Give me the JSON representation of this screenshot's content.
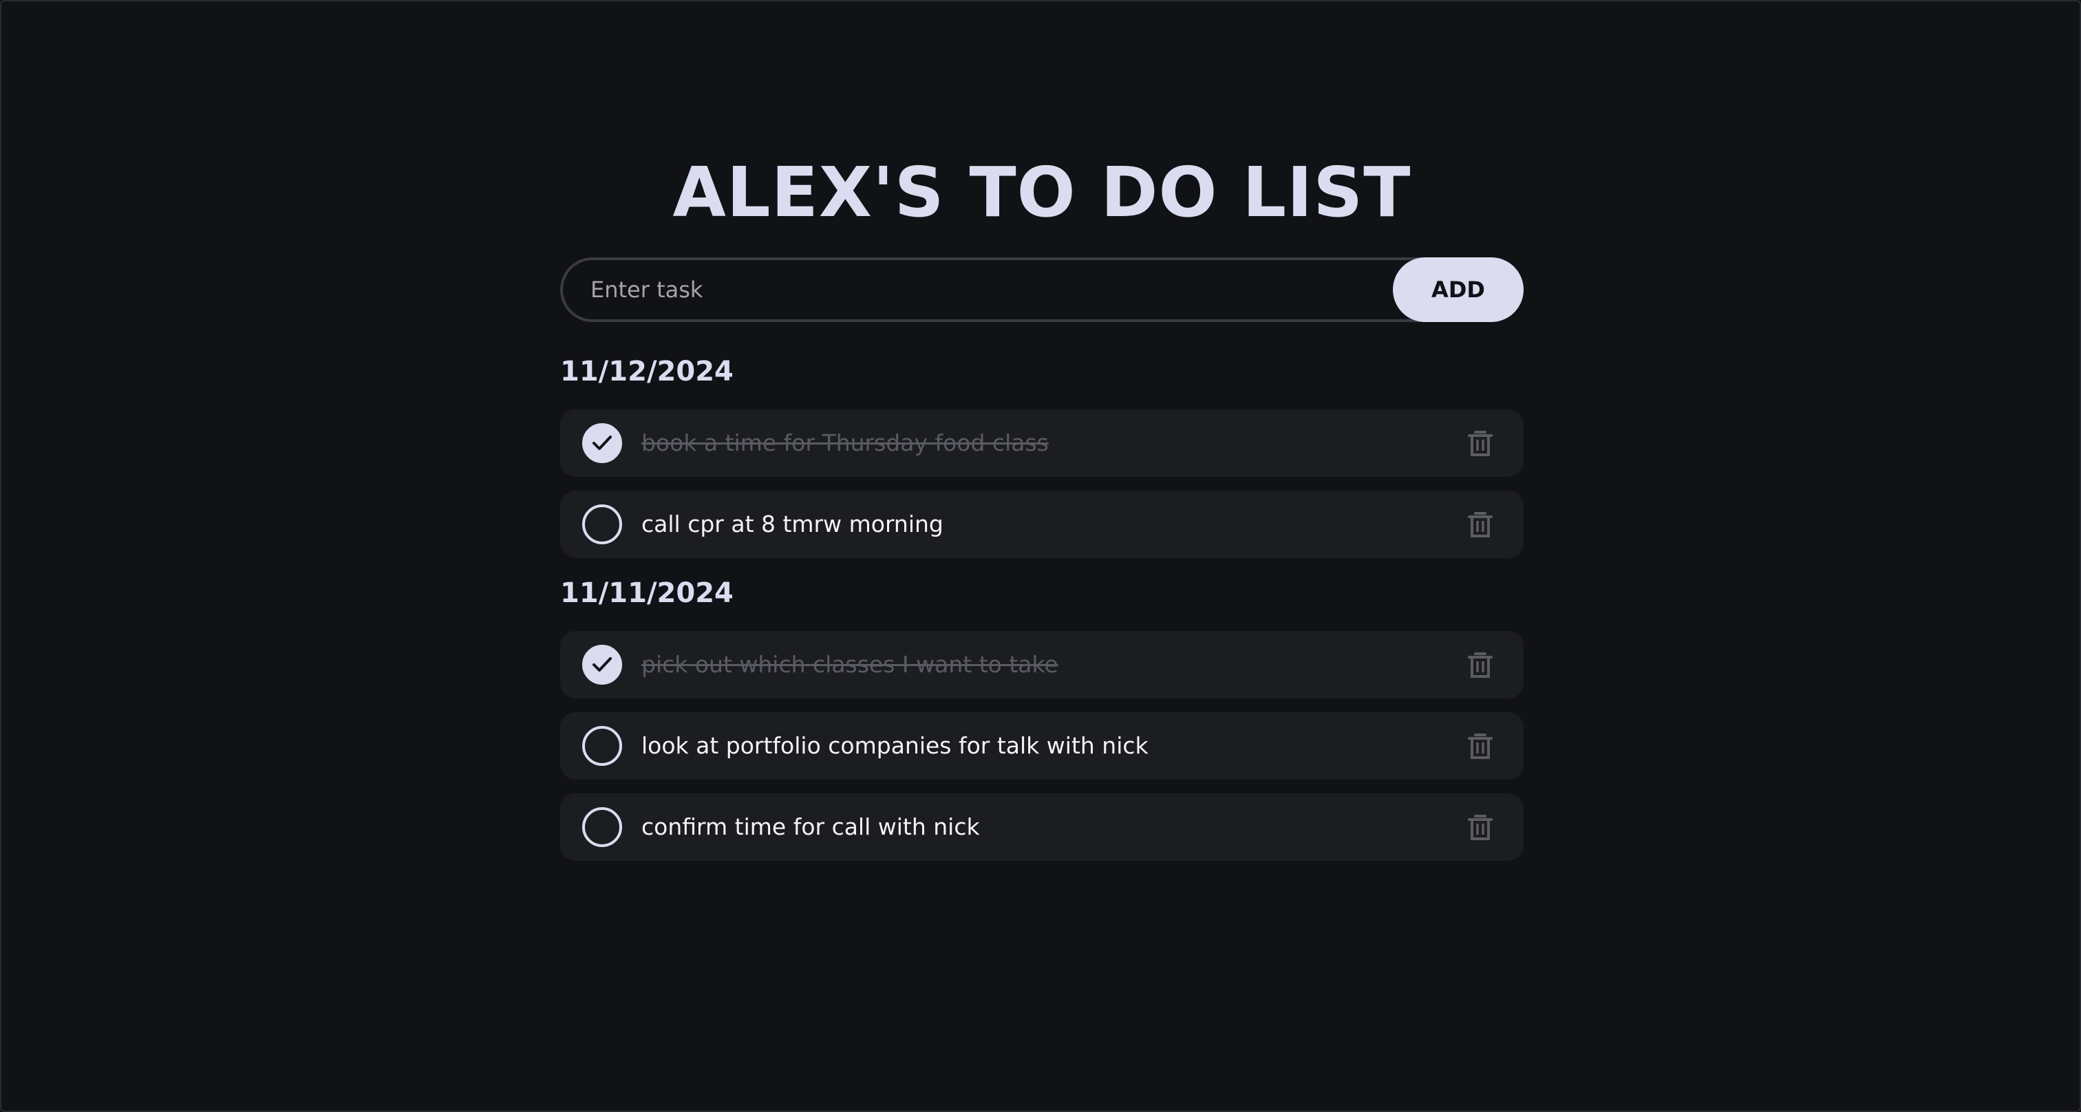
{
  "title": "ALEX'S TO DO LIST",
  "input": {
    "placeholder": "Enter task",
    "value": ""
  },
  "add_button_label": "ADD",
  "colors": {
    "background": "#111216",
    "accent": "#dcdcf0",
    "row_background": "#1c1d21",
    "done_text": "#5a5b62"
  },
  "groups": [
    {
      "date": "11/12/2024",
      "tasks": [
        {
          "text": "book a time for Thursday food class",
          "done": true
        },
        {
          "text": "call cpr at 8 tmrw morning",
          "done": false
        }
      ]
    },
    {
      "date": "11/11/2024",
      "tasks": [
        {
          "text": "pick out which classes I want to take",
          "done": true
        },
        {
          "text": "look at portfolio companies for talk with nick",
          "done": false
        },
        {
          "text": "confirm time for call with nick",
          "done": false
        }
      ]
    }
  ],
  "icons": {
    "check": "check-icon",
    "delete": "trash-icon"
  }
}
